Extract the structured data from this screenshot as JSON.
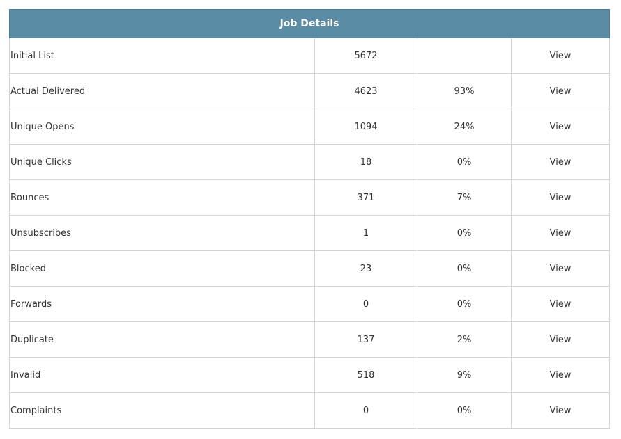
{
  "table": {
    "title": "Job Details",
    "rows": [
      {
        "label": "Initial List",
        "count": "5672",
        "percent": "",
        "action": "View"
      },
      {
        "label": "Actual Delivered",
        "count": "4623",
        "percent": "93%",
        "action": "View"
      },
      {
        "label": "Unique Opens",
        "count": "1094",
        "percent": "24%",
        "action": "View"
      },
      {
        "label": "Unique Clicks",
        "count": "18",
        "percent": "0%",
        "action": "View"
      },
      {
        "label": "Bounces",
        "count": "371",
        "percent": "7%",
        "action": "View"
      },
      {
        "label": "Unsubscribes",
        "count": "1",
        "percent": "0%",
        "action": "View"
      },
      {
        "label": "Blocked",
        "count": "23",
        "percent": "0%",
        "action": "View"
      },
      {
        "label": "Forwards",
        "count": "0",
        "percent": "0%",
        "action": "View"
      },
      {
        "label": "Duplicate",
        "count": "137",
        "percent": "2%",
        "action": "View"
      },
      {
        "label": "Invalid",
        "count": "518",
        "percent": "9%",
        "action": "View"
      },
      {
        "label": "Complaints",
        "count": "0",
        "percent": "0%",
        "action": "View"
      }
    ]
  },
  "colors": {
    "header_bg": "#5b8ca5",
    "header_text": "#ffffff",
    "border": "#d4d4d4",
    "text": "#333333"
  }
}
